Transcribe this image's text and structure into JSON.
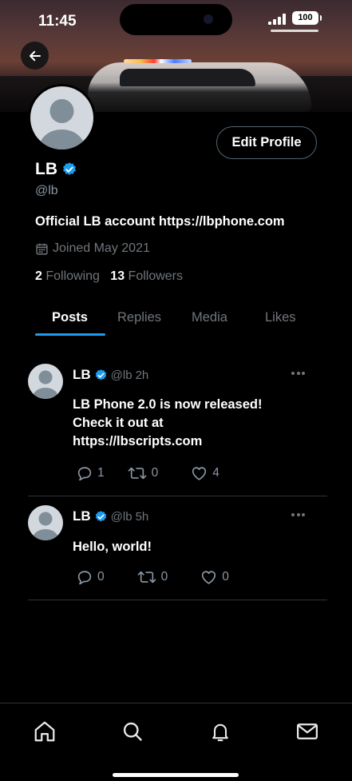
{
  "status_bar": {
    "time": "11:45",
    "battery": "100"
  },
  "profile": {
    "name": "LB",
    "handle": "@lb",
    "bio": "Official LB account https://lbphone.com",
    "joined": "Joined May 2021",
    "following_count": "2",
    "following_label": "Following",
    "followers_count": "13",
    "followers_label": "Followers",
    "edit_profile_label": "Edit Profile"
  },
  "tabs": [
    {
      "label": "Posts",
      "active": true
    },
    {
      "label": "Replies",
      "active": false
    },
    {
      "label": "Media",
      "active": false
    },
    {
      "label": "Likes",
      "active": false
    }
  ],
  "posts": [
    {
      "name": "LB",
      "handle": "@lb",
      "time": "2h",
      "lines": [
        "LB Phone 2.0 is now released!",
        "Check it out at",
        "https://lbscripts.com"
      ],
      "replies": "1",
      "reposts": "0",
      "likes": "4"
    },
    {
      "name": "LB",
      "handle": "@lb",
      "time": "5h",
      "lines": [
        "Hello, world!"
      ],
      "replies": "0",
      "reposts": "0",
      "likes": "0"
    }
  ],
  "icons": {
    "back": "arrow-left-icon",
    "verified": "verified-badge-icon",
    "calendar": "calendar-icon",
    "more": "more-dots-icon",
    "reply": "reply-bubble-icon",
    "repost": "repost-icon",
    "like": "heart-icon",
    "nav": [
      "home-icon",
      "search-icon",
      "bell-icon",
      "mail-icon"
    ]
  },
  "colors": {
    "accent": "#1d9bf0",
    "muted": "#71767b",
    "background": "#000000"
  }
}
